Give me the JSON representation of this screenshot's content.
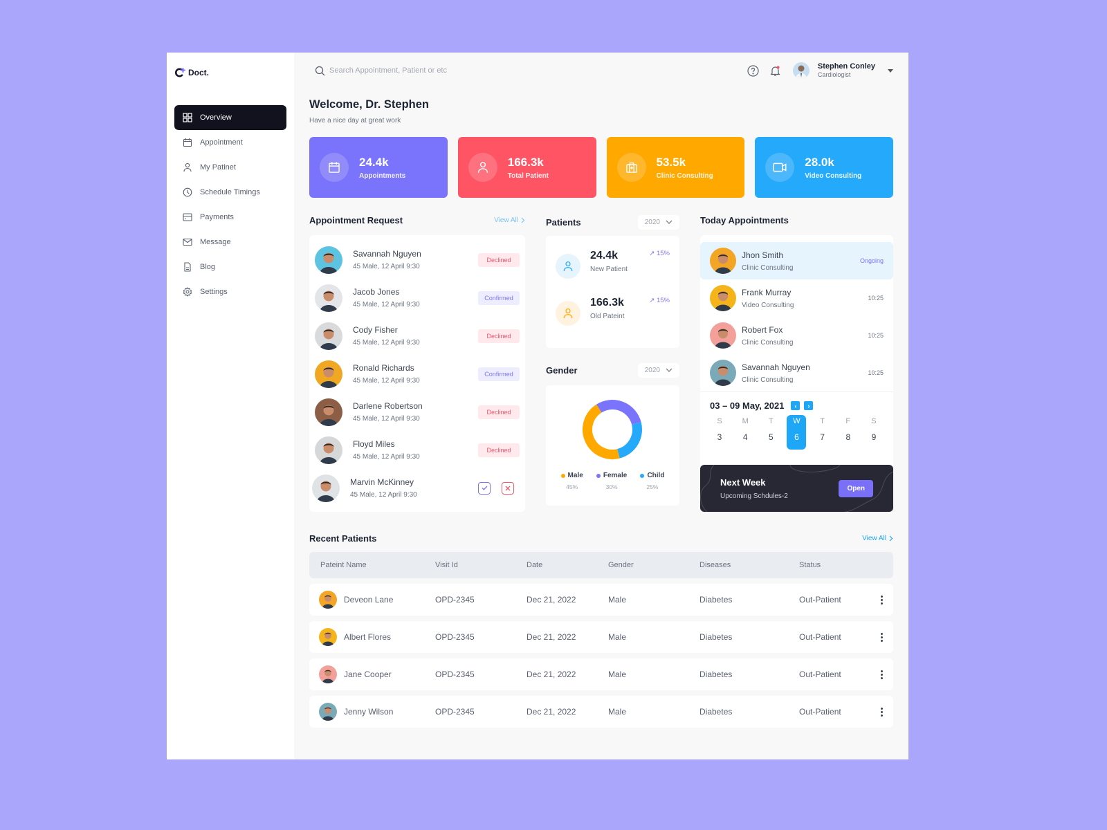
{
  "app": {
    "logo": "Doct."
  },
  "sidebar": {
    "items": [
      {
        "label": "Overview",
        "icon": "grid-icon",
        "active": true
      },
      {
        "label": "Appointment",
        "icon": "calendar-icon"
      },
      {
        "label": "My Patinet",
        "icon": "user-icon"
      },
      {
        "label": "Schedule Timings",
        "icon": "clock-icon"
      },
      {
        "label": "Payments",
        "icon": "card-icon"
      },
      {
        "label": "Message",
        "icon": "mail-icon"
      },
      {
        "label": "Blog",
        "icon": "document-icon"
      },
      {
        "label": "Settings",
        "icon": "gear-icon"
      }
    ]
  },
  "topbar": {
    "search_placeholder": "Search Appointment, Patient or etc",
    "user_name": "Stephen Conley",
    "user_role": "Cardiologist"
  },
  "welcome": {
    "title": "Welcome, Dr. Stephen",
    "subtitle": "Have a nice day at great work"
  },
  "stats": [
    {
      "value": "24.4k",
      "label": "Appointments",
      "color": "#7a73fb",
      "icon": "calendar-icon"
    },
    {
      "value": "166.3k",
      "label": "Total Patient",
      "color": "#fe5464",
      "icon": "user-icon"
    },
    {
      "value": "53.5k",
      "label": "Clinic Consulting",
      "color": "#ffa800",
      "icon": "briefcase-icon"
    },
    {
      "value": "28.0k",
      "label": "Video Consulting",
      "color": "#25a9fa",
      "icon": "video-icon"
    }
  ],
  "appointment_request": {
    "title": "Appointment Request",
    "view_all": "View All",
    "items": [
      {
        "name": "Savannah Nguyen",
        "detail": "45 Male, 12 April 9:30",
        "status": "Declined",
        "avatar_bg": "#5cc4e0"
      },
      {
        "name": "Jacob Jones",
        "detail": "45 Male, 12 April 9:30",
        "status": "Confirmed",
        "avatar_bg": "#e3e5e8"
      },
      {
        "name": "Cody Fisher",
        "detail": "45 Male, 12 April 9:30",
        "status": "Declined",
        "avatar_bg": "#d9dadc"
      },
      {
        "name": "Ronald Richards",
        "detail": "45 Male, 12 April 9:30",
        "status": "Confirmed",
        "avatar_bg": "#f0a722"
      },
      {
        "name": "Darlene Robertson",
        "detail": "45 Male, 12 April 9:30",
        "status": "Declined",
        "avatar_bg": "#8b5e45"
      },
      {
        "name": "Floyd Miles",
        "detail": "45 Male, 12 April 9:30",
        "status": "Declined",
        "avatar_bg": "#d6d7d9"
      },
      {
        "name": "Marvin McKinney",
        "detail": "45 Male, 12 April 9:30",
        "status": "pending",
        "avatar_bg": "#dfe3e6"
      }
    ]
  },
  "patients": {
    "title": "Patients",
    "year": "2020",
    "items": [
      {
        "value": "24.4k",
        "label": "New Patient",
        "trend": "15%",
        "color": "#25a9fa",
        "bg": "#e6f4fd"
      },
      {
        "value": "166.3k",
        "label": "Old Pateint",
        "trend": "15%",
        "color": "#ffa800",
        "bg": "#fff3e0"
      }
    ]
  },
  "gender": {
    "title": "Gender",
    "year": "2020"
  },
  "chart_data": {
    "type": "pie",
    "title": "Gender",
    "categories": [
      "Male",
      "Female",
      "Child"
    ],
    "values": [
      45,
      30,
      25
    ],
    "labels": [
      "45%",
      "30%",
      "25%"
    ],
    "colors": [
      "#ffa800",
      "#7a73fb",
      "#25a9fa"
    ],
    "legend": "bottom"
  },
  "today_appointments": {
    "title": "Today Appointments",
    "items": [
      {
        "name": "Jhon Smith",
        "type": "Clinic Consulting",
        "time": "Ongoing",
        "ongoing": true,
        "avatar_bg": "#f3a526"
      },
      {
        "name": "Frank Murray",
        "type": "Video Consulting",
        "time": "10:25",
        "avatar_bg": "#f4b41a"
      },
      {
        "name": "Robert Fox",
        "type": "Clinic Consulting",
        "time": "10:25",
        "avatar_bg": "#f3a09b"
      },
      {
        "name": "Savannah Nguyen",
        "type": "Clinic Consulting",
        "time": "10:25",
        "avatar_bg": "#7aa9b8"
      }
    ]
  },
  "calendar": {
    "range": "03 – 09 May, 2021",
    "days": [
      {
        "w": "S",
        "n": "3"
      },
      {
        "w": "M",
        "n": "4"
      },
      {
        "w": "T",
        "n": "5"
      },
      {
        "w": "W",
        "n": "6",
        "selected": true
      },
      {
        "w": "T",
        "n": "7"
      },
      {
        "w": "F",
        "n": "8"
      },
      {
        "w": "S",
        "n": "9"
      }
    ]
  },
  "next_week": {
    "title": "Next Week",
    "subtitle": "Upcoming Schdules-2",
    "button": "Open"
  },
  "recent_patients": {
    "title": "Recent Patients",
    "view_all": "View All",
    "columns": [
      "Pateint Name",
      "Visit Id",
      "Date",
      "Gender",
      "Diseases",
      "Status"
    ],
    "rows": [
      {
        "name": "Deveon Lane",
        "visit": "OPD-2345",
        "date": "Dec 21, 2022",
        "gender": "Male",
        "disease": "Diabetes",
        "status": "Out-Patient",
        "avatar_bg": "#f3a526"
      },
      {
        "name": "Albert Flores",
        "visit": "OPD-2345",
        "date": "Dec 21, 2022",
        "gender": "Male",
        "disease": "Diabetes",
        "status": "Out-Patient",
        "avatar_bg": "#f4b41a"
      },
      {
        "name": "Jane Cooper",
        "visit": "OPD-2345",
        "date": "Dec 21, 2022",
        "gender": "Male",
        "disease": "Diabetes",
        "status": "Out-Patient",
        "avatar_bg": "#f3a09b"
      },
      {
        "name": "Jenny Wilson",
        "visit": "OPD-2345",
        "date": "Dec 21, 2022",
        "gender": "Male",
        "disease": "Diabetes",
        "status": "Out-Patient",
        "avatar_bg": "#7aa9b8"
      }
    ]
  }
}
